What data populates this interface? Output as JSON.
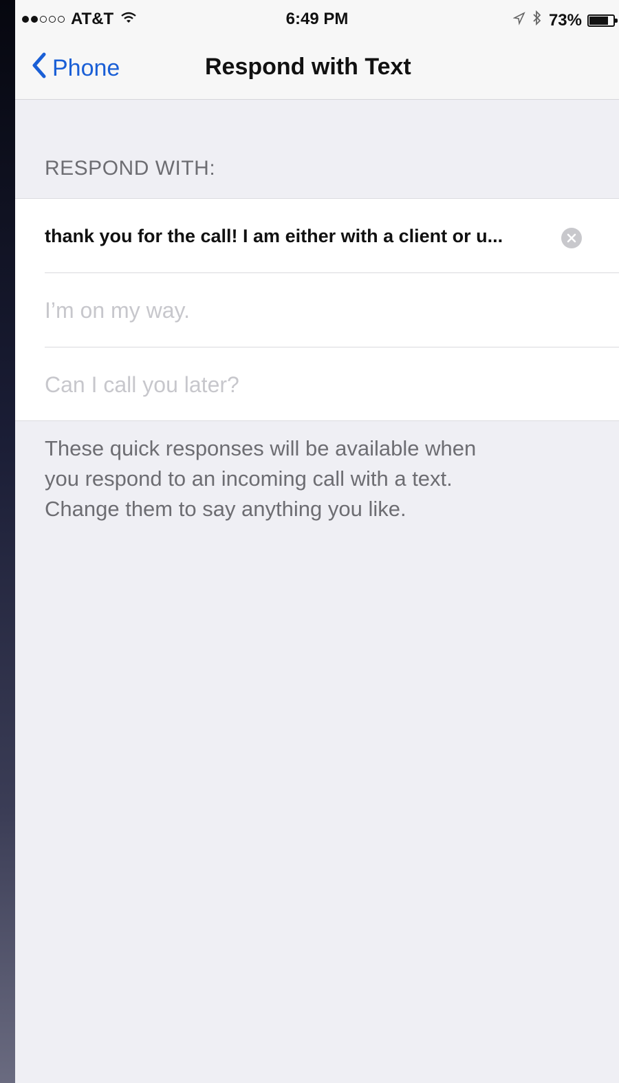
{
  "status_bar": {
    "carrier": "AT&T",
    "time": "6:49 PM",
    "battery": "73%",
    "signal_bars_filled": 2,
    "signal_bars_total": 5
  },
  "nav": {
    "back_label": "Phone",
    "title": "Respond with Text"
  },
  "section": {
    "header": "RESPOND WITH:"
  },
  "responses": [
    {
      "value": "thank you for the call! I am either with a client or u...",
      "placeholder": ""
    },
    {
      "value": "",
      "placeholder": "I’m on my way."
    },
    {
      "value": "",
      "placeholder": "Can I call you later?"
    }
  ],
  "footer": {
    "note_lines": [
      "These quick responses will be available when",
      "you respond to an incoming call with a text.",
      "Change them to say anything you like."
    ]
  },
  "colors": {
    "accent": "#1a5fd6",
    "background": "#efeff4",
    "placeholder": "#c7c7cc",
    "secondary_text": "#6d6d72"
  },
  "icons": [
    "signal-dots-icon",
    "wifi-icon",
    "location-arrow-icon",
    "bluetooth-icon",
    "battery-icon",
    "chevron-left-icon",
    "clear-text-icon"
  ]
}
